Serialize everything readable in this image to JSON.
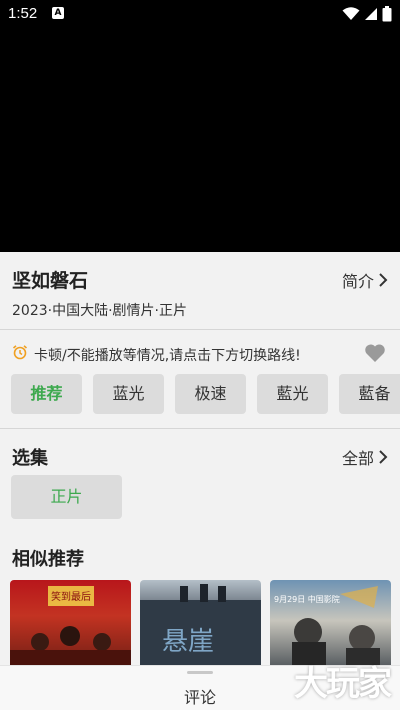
{
  "status_bar": {
    "time": "1:52",
    "notification_letter": "A"
  },
  "movie": {
    "title": "坚如磐石",
    "intro_label": "简介",
    "meta": "2023·中国大陆·剧情片·正片"
  },
  "notice": {
    "text": "卡顿/不能播放等情况,请点击下方切换路线!"
  },
  "sources": [
    {
      "label": "推荐",
      "active": true
    },
    {
      "label": "蓝光",
      "active": false
    },
    {
      "label": "极速",
      "active": false
    },
    {
      "label": "藍光",
      "active": false
    },
    {
      "label": "藍备",
      "active": false
    }
  ],
  "episodes": {
    "title": "选集",
    "all_label": "全部",
    "items": [
      {
        "label": "正片"
      }
    ]
  },
  "similar": {
    "title": "相似推荐",
    "posters": [
      {
        "caption": "笑到最后"
      },
      {
        "caption": "悬崖"
      },
      {
        "caption": "9月29日 中国影院"
      }
    ]
  },
  "bottom_bar": {
    "comment_label": "评论"
  },
  "watermark": "大玩家",
  "colors": {
    "accent_green": "#3da94e",
    "background": "#f2f2f2",
    "button_bg": "#dcdcdc",
    "notice_orange": "#f0a021"
  }
}
